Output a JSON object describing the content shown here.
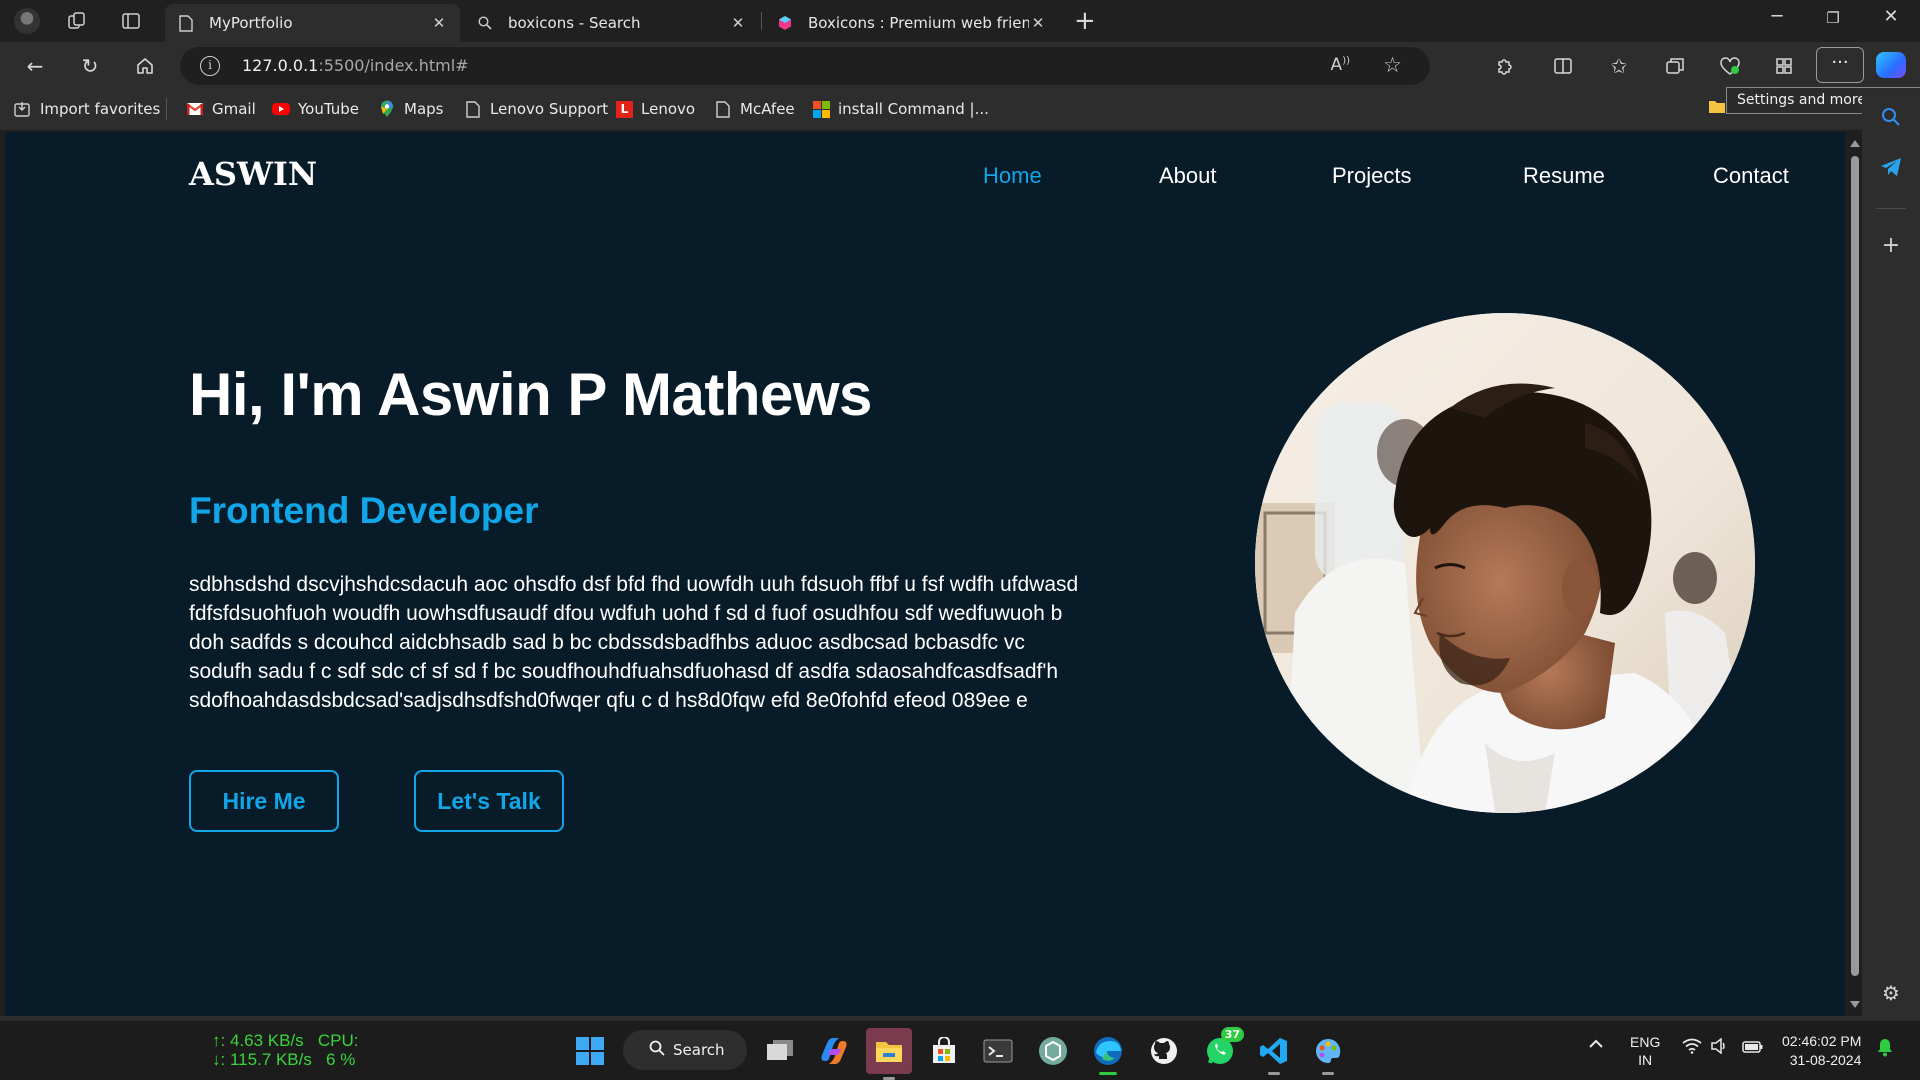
{
  "browser": {
    "tabs": [
      {
        "title": "MyPortfolio",
        "icon": "page-icon",
        "active": true
      },
      {
        "title": "boxicons - Search",
        "icon": "search-icon",
        "active": false
      },
      {
        "title": "Boxicons : Premium web friendly i",
        "icon": "boxicons-logo-icon",
        "active": false
      }
    ],
    "url_host": "127.0.0.1",
    "url_path": ":5500/index.html#",
    "favorites": [
      {
        "label": "Import favorites",
        "icon": "import-icon"
      },
      {
        "label": "Gmail",
        "icon": "gmail-icon"
      },
      {
        "label": "YouTube",
        "icon": "youtube-icon"
      },
      {
        "label": "Maps",
        "icon": "maps-pin-icon"
      },
      {
        "label": "Lenovo Support",
        "icon": "page-icon"
      },
      {
        "label": "Lenovo",
        "icon": "lenovo-icon"
      },
      {
        "label": "McAfee",
        "icon": "page-icon"
      },
      {
        "label": "install Command |...",
        "icon": "microsoft-icon"
      }
    ],
    "tooltip": "Settings and more (Alt+F)",
    "more_label": "···"
  },
  "site": {
    "logo": "ASWIN",
    "nav": [
      "Home",
      "About",
      "Projects",
      "Resume",
      "Contact"
    ],
    "active_nav": "Home",
    "title": "Hi, I'm Aswin P Mathews",
    "subtitle": "Frontend Developer",
    "description": "sdbhsdshd dscvjhshdcsdacuh aoc ohsdfo dsf bfd fhd uowfdh uuh fdsuoh ffbf u fsf wdfh ufdwasd fdfsfdsuohfuoh woudfh uowhsdfusaudf dfou wdfuh uohd f sd d fuof osudhfou sdf wedfuwuoh b doh sadfds s dcouhcd aidcbhsadb sad b bc cbdssdsbadfhbs aduoc asdbcsad bcbasdfc vc sodufh sadu f c sdf sdc cf sf sd f bc soudfhouhdfuahsdfuohasd df asdfa sdaosahdfcasdfsadf'h sdofhoahdasdsbdcsad'sadjsdhsdfshd0fwqer qfu c d hs8d0fqw efd 8e0fohfd efeod 089ee e",
    "buttons": [
      "Hire Me",
      "Let's Talk"
    ],
    "accent_color": "#10a6e8",
    "background_color": "#081b29"
  },
  "taskbar": {
    "net_up": "↑: 4.63 KB/s",
    "net_down": "↓: 115.7 KB/s",
    "cpu_label": "CPU:",
    "cpu_value": "6 %",
    "search_label": "Search",
    "whatsapp_badge": "37",
    "lang_top": "ENG",
    "lang_bottom": "IN",
    "time": "02:46:02 PM",
    "date": "31-08-2024"
  }
}
